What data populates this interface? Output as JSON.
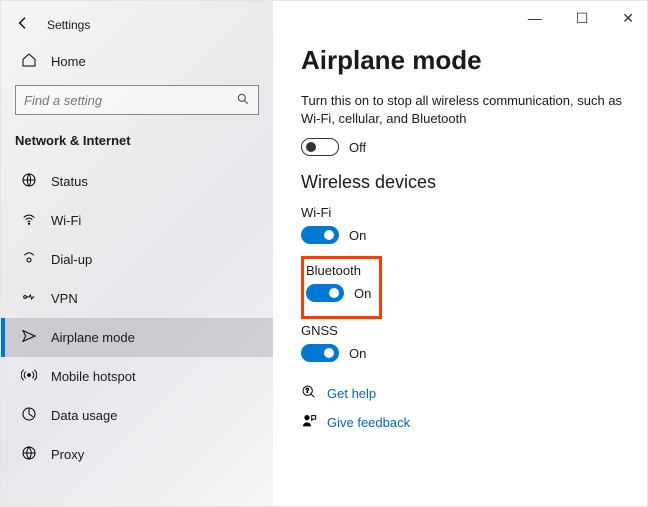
{
  "window": {
    "title": "Settings",
    "minimize": "—",
    "maximize": "☐",
    "close": "✕"
  },
  "sidebar": {
    "home": "Home",
    "search_placeholder": "Find a setting",
    "section": "Network & Internet",
    "items": [
      {
        "label": "Status"
      },
      {
        "label": "Wi-Fi"
      },
      {
        "label": "Dial-up"
      },
      {
        "label": "VPN"
      },
      {
        "label": "Airplane mode",
        "selected": true
      },
      {
        "label": "Mobile hotspot"
      },
      {
        "label": "Data usage"
      },
      {
        "label": "Proxy"
      }
    ]
  },
  "main": {
    "title": "Airplane mode",
    "description": "Turn this on to stop all wireless communication, such as Wi-Fi, cellular, and Bluetooth",
    "airplane_toggle": {
      "state_label": "Off",
      "on": false
    },
    "wireless_heading": "Wireless devices",
    "devices": [
      {
        "label": "Wi-Fi",
        "state_label": "On",
        "on": true
      },
      {
        "label": "Bluetooth",
        "state_label": "On",
        "on": true,
        "highlighted": true
      },
      {
        "label": "GNSS",
        "state_label": "On",
        "on": true
      }
    ],
    "links": {
      "help": "Get help",
      "feedback": "Give feedback"
    }
  }
}
